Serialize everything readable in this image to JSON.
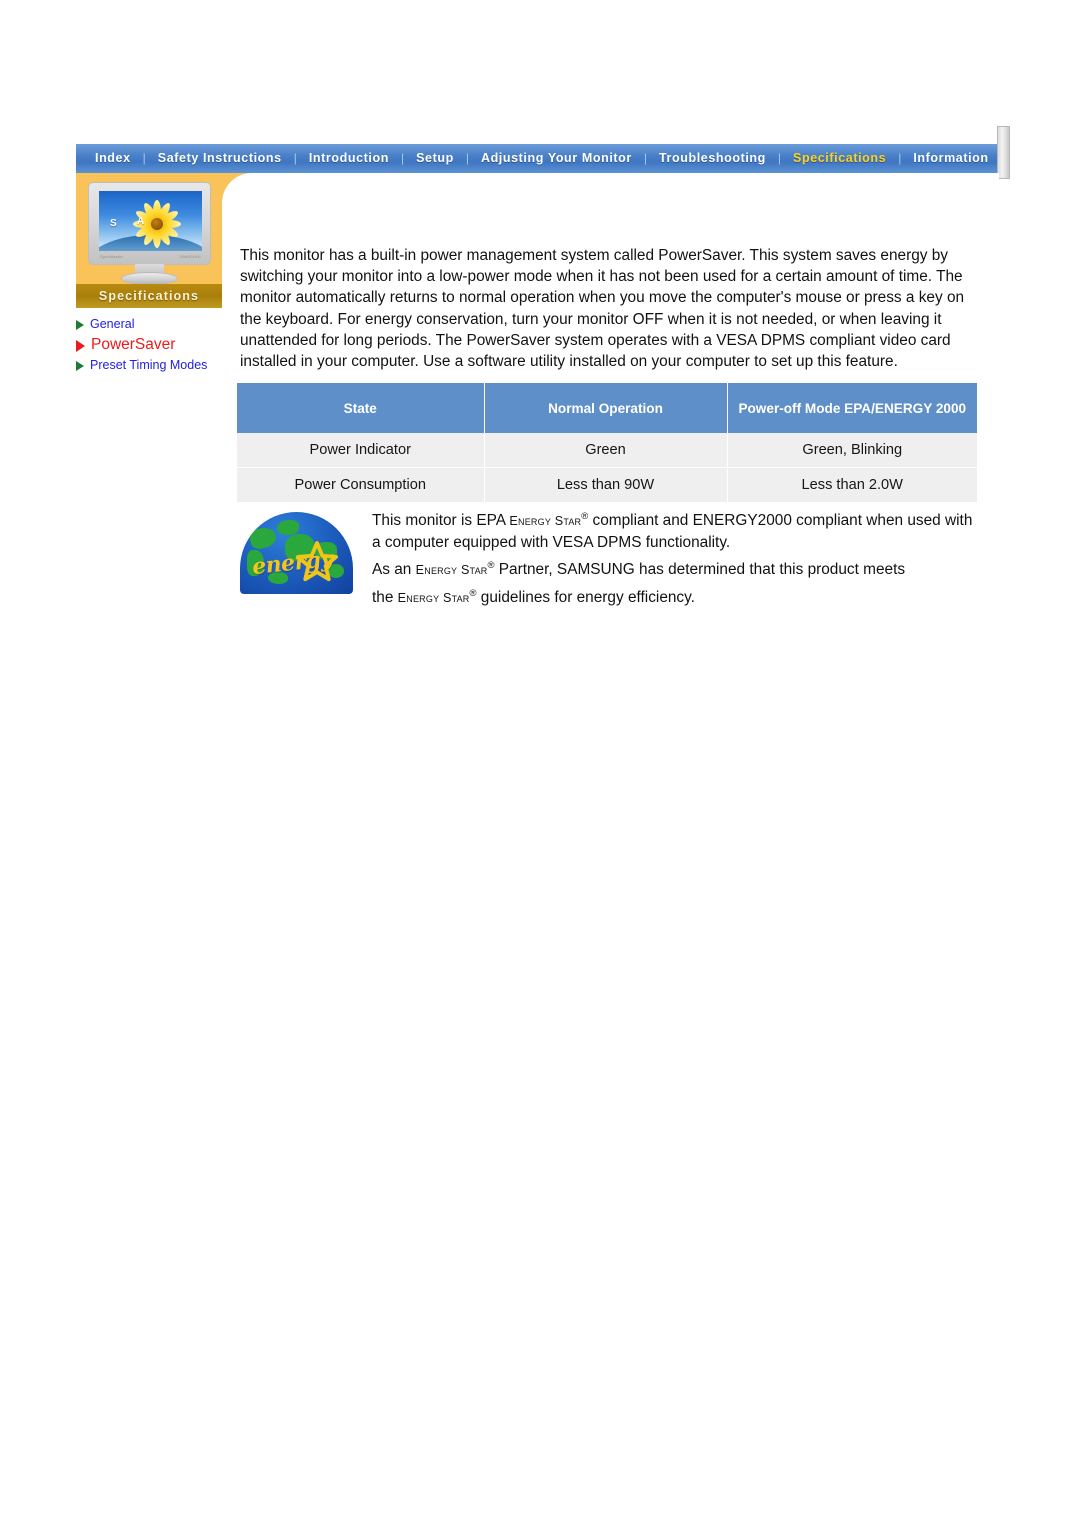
{
  "nav": {
    "items": [
      {
        "label": "Index",
        "active": false
      },
      {
        "label": "Safety Instructions",
        "active": false
      },
      {
        "label": "Introduction",
        "active": false
      },
      {
        "label": "Setup",
        "active": false
      },
      {
        "label": "Adjusting Your Monitor",
        "active": false
      },
      {
        "label": "Troubleshooting",
        "active": false
      },
      {
        "label": "Specifications",
        "active": true
      },
      {
        "label": "Information",
        "active": false
      }
    ],
    "separator": "|",
    "active_color": "#ffd21e",
    "bar_color": "#4b81c8"
  },
  "sidebar": {
    "banner_label": "Specifications",
    "banner_color": "#b98b10",
    "panel_color": "#f9c35a",
    "monitor": {
      "brand_letter_s": "S",
      "brand_letter_a": "A",
      "badge_left": "SyncMaster",
      "badge_right": "SAMSUNG"
    },
    "links": [
      {
        "label": "General",
        "current": false,
        "color": "#2020e8",
        "arrow_color": "#1e7a34"
      },
      {
        "label": "PowerSaver",
        "current": true,
        "color": "#ef1b1b",
        "arrow_color": "#e81c1c"
      },
      {
        "label": "Preset Timing Modes",
        "current": false,
        "color": "#2020e8",
        "arrow_color": "#1e7a34"
      }
    ]
  },
  "main": {
    "intro_paragraph": "This monitor has a built-in power management system called PowerSaver. This system saves energy by switching your monitor into a low-power mode when it has not been used for a certain amount of time. The monitor automatically returns to normal operation when you move the computer's mouse or press a key on the keyboard. For energy conservation, turn your monitor OFF when it is not needed, or when leaving it unattended for long periods. The PowerSaver system operates with a VESA DPMS compliant video card installed in your computer. Use a software utility installed on your computer to set up this feature.",
    "table": {
      "header_color": "#5e8fc9",
      "row_color": "#efefef",
      "columns": [
        "State",
        "Normal Operation",
        "Power-off Mode EPA/ENERGY 2000"
      ],
      "rows": [
        [
          "Power Indicator",
          "Green",
          "Green, Blinking"
        ],
        [
          "Power Consumption",
          "Less than 90W",
          "Less than 2.0W"
        ]
      ]
    },
    "energy_star": {
      "logo_word": "energy",
      "line1_a": "This monitor is EPA ",
      "line1_sc1": "Energy Star",
      "line1_b": " compliant and ENERGY2000 compliant when used with a computer equipped with VESA DPMS functionality.",
      "line2_a": "As an ",
      "line2_sc": "Energy Star",
      "line2_b": " Partner, SAMSUNG has determined that this product meets",
      "line3_a": "the ",
      "line3_sc": "Energy Star",
      "line3_b": " guidelines for energy efficiency.",
      "registered_mark": "®"
    }
  }
}
